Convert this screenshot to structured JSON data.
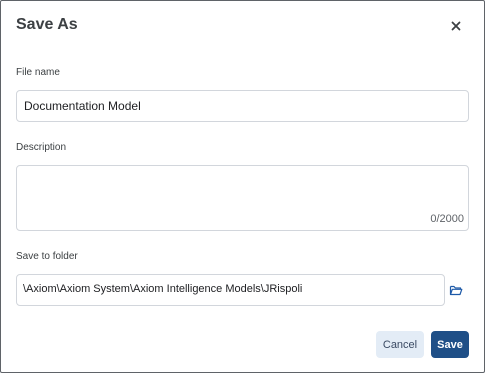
{
  "dialog": {
    "title": "Save As",
    "close_icon": "close-icon"
  },
  "file_name": {
    "label": "File name",
    "value": "Documentation Model"
  },
  "description": {
    "label": "Description",
    "value": "",
    "counter": "0/2000"
  },
  "folder": {
    "label": "Save to folder",
    "value": "\\Axiom\\Axiom System\\Axiom Intelligence Models\\JRispoli",
    "browse_icon": "folder-icon"
  },
  "buttons": {
    "cancel": "Cancel",
    "save": "Save"
  },
  "colors": {
    "primary": "#1f4f87",
    "secondary_bg": "#e3ecf6",
    "folder_icon": "#1e5aa8"
  }
}
